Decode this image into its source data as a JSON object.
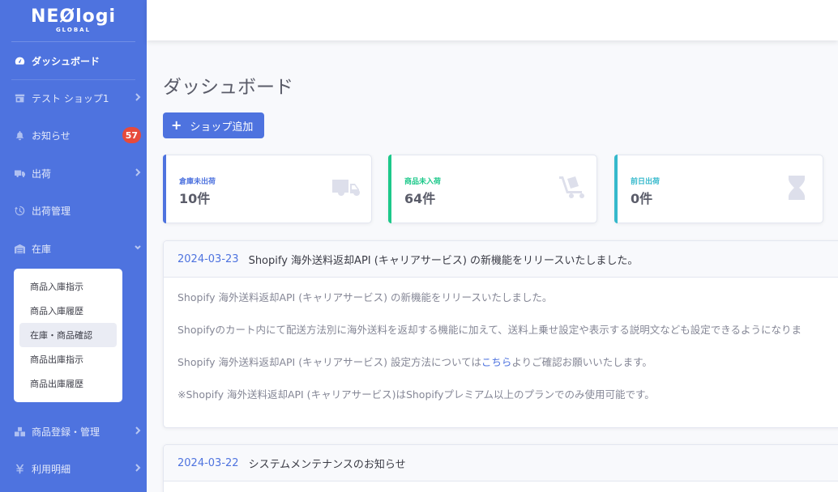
{
  "brand": {
    "main": "NEØlogi",
    "sub": "GLOBAL"
  },
  "sidebar": {
    "items": [
      {
        "label": "ダッシュボード",
        "icon": "tachometer-icon"
      },
      {
        "label": "テスト ショップ1",
        "icon": "store-icon"
      },
      {
        "label": "お知らせ",
        "icon": "bell-icon",
        "badge": "57"
      },
      {
        "label": "出荷",
        "icon": "truck-icon"
      },
      {
        "label": "出荷管理",
        "icon": "history-icon"
      },
      {
        "label": "在庫",
        "icon": "warehouse-icon"
      },
      {
        "label": "商品登録・管理",
        "icon": "boxes-icon"
      },
      {
        "label": "利用明細",
        "icon": "yen-icon"
      }
    ],
    "stock_submenu": [
      "商品入庫指示",
      "商品入庫履歴",
      "在庫・商品確認",
      "商品出庫指示",
      "商品出庫履歴"
    ]
  },
  "page": {
    "title": "ダッシュボード",
    "add_button": "ショップ追加"
  },
  "stats": [
    {
      "label": "倉庫未出荷",
      "value": "10件",
      "color": "#4e73df",
      "icon": "truck-icon"
    },
    {
      "label": "商品未入荷",
      "value": "64件",
      "color": "#1cc88a",
      "icon": "dolly-icon"
    },
    {
      "label": "前日出荷",
      "value": "0件",
      "color": "#36b9cc",
      "icon": "hourglass-icon"
    }
  ],
  "news": [
    {
      "date": "2024-03-23",
      "title": "Shopify 海外送料返却API (キャリアサービス) の新機能をリリースいたしました。",
      "body": {
        "p1": "Shopify 海外送料返却API (キャリアサービス) の新機能をリリースいたしました。",
        "p2": "Shopifyのカート内にて配送方法別に海外送料を返却する機能に加えて、送料上乗せ設定や表示する説明文なども設定できるようになりま",
        "p3_before": "Shopify 海外送料返却API (キャリアサービス) 設定方法については",
        "p3_link": "こちら",
        "p3_after": "よりご確認お願いいたします。",
        "p4": "※Shopify 海外送料返却API (キャリアサービス)はShopifyプレミアム以上のプランでのみ使用可能です。"
      }
    },
    {
      "date": "2024-03-22",
      "title": "システムメンテナンスのお知らせ"
    }
  ],
  "colors": {
    "primary": "#4e73df",
    "success": "#1cc88a",
    "info": "#36b9cc",
    "danger": "#e74a3b"
  }
}
